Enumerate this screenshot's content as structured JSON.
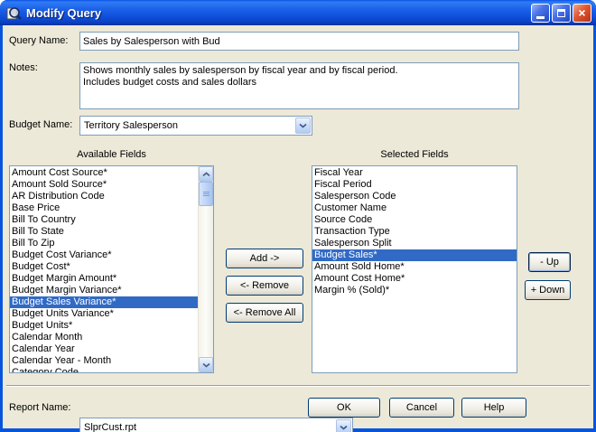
{
  "window": {
    "title": "Modify Query",
    "icon": "query-magnifier-icon",
    "controls": {
      "minimize": "minimize",
      "maximize": "maximize",
      "close": "close"
    }
  },
  "form": {
    "query_name": {
      "label": "Query Name:",
      "value": "Sales by Salesperson with Bud"
    },
    "notes": {
      "label": "Notes:",
      "value": "Shows monthly sales by salesperson by fiscal year and by fiscal period.\nIncludes budget costs and sales dollars"
    },
    "budget_name": {
      "label": "Budget Name:",
      "value": "Territory Salesperson"
    },
    "report_name": {
      "label": "Report Name:",
      "value": "SlprCust.rpt"
    }
  },
  "available": {
    "label": "Available Fields",
    "selected_index": 11,
    "items": [
      "Amount Cost Source*",
      "Amount Sold Source*",
      "AR Distribution Code",
      "Base Price",
      "Bill To Country",
      "Bill To State",
      "Bill To Zip",
      "Budget Cost Variance*",
      "Budget Cost*",
      "Budget Margin Amount*",
      "Budget Margin Variance*",
      "Budget Sales Variance*",
      "Budget Units Variance*",
      "Budget Units*",
      "Calendar Month",
      "Calendar Year",
      "Calendar Year - Month",
      "Category Code"
    ]
  },
  "selected": {
    "label": "Selected Fields",
    "selected_index": 7,
    "items": [
      "Fiscal Year",
      "Fiscal Period",
      "Salesperson Code",
      "Customer Name",
      "Source Code",
      "Transaction Type",
      "Salesperson Split",
      "Budget Sales*",
      "Amount Sold Home*",
      "Amount Cost Home*",
      "Margin % (Sold)*"
    ]
  },
  "buttons": {
    "add": "Add ->",
    "remove": "<- Remove",
    "remove_all": "<- Remove All",
    "up": "- Up",
    "down": "+ Down",
    "ok": "OK",
    "cancel": "Cancel",
    "help": "Help"
  },
  "colors": {
    "dialog_bg": "#ECE9D8",
    "selection_blue": "#316AC5",
    "titlebar_blue": "#1153DF",
    "window_border_blue": "#0855DD",
    "close_red": "#D6492A",
    "field_border": "#7F9DB9"
  }
}
